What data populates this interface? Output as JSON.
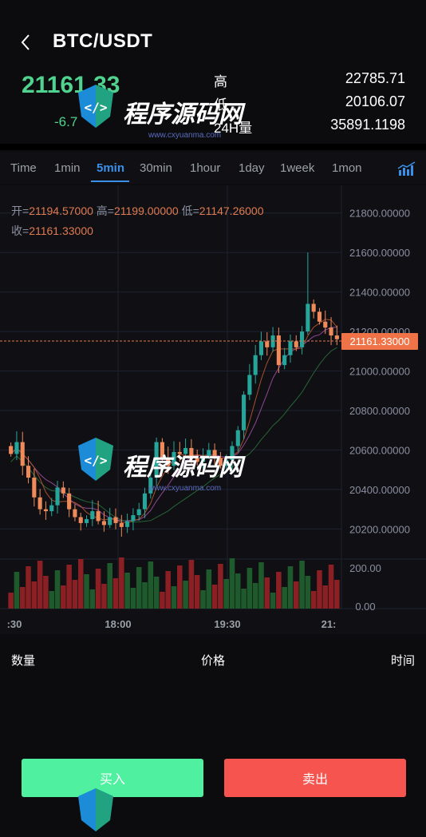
{
  "header": {
    "title": "BTC/USDT",
    "price": "21161.33",
    "change": "-6.7",
    "stats": [
      {
        "label": "高",
        "value": "22785.71"
      },
      {
        "label": "低",
        "value": "20106.07"
      },
      {
        "label": "24H量",
        "value": "35891.1198"
      }
    ]
  },
  "tabs": [
    "Time",
    "1min",
    "5min",
    "30min",
    "1hour",
    "1day",
    "1week",
    "1mon"
  ],
  "active_tab": "5min",
  "ohlc": {
    "open_label": "开=",
    "open": "21194.57000",
    "high_label": "高=",
    "high": "21199.00000",
    "low_label": "低=",
    "low": "21147.26000",
    "close_label": "收=",
    "close": "21161.33000"
  },
  "chart_data": {
    "type": "candlestick",
    "y_ticks": [
      "21800.00000",
      "21600.00000",
      "21400.00000",
      "21200.00000",
      "21000.00000",
      "20800.00000",
      "20600.00000",
      "20400.00000",
      "20200.00000"
    ],
    "ylim": [
      20080,
      21900
    ],
    "last_price_label": "21161.33000",
    "x_ticks": [
      ":30",
      "18:00",
      "19:30",
      "21:"
    ],
    "volume_ticks": [
      "200.00",
      "0.00"
    ]
  },
  "orderbook": {
    "qty": "数量",
    "price": "价格",
    "time": "时间"
  },
  "buttons": {
    "buy": "买入",
    "sell": "卖出"
  },
  "watermark": {
    "text": "程序源码网",
    "url": "www.cxyuanma.com"
  },
  "colors": {
    "up": "#26a69a",
    "down": "#ef5350",
    "green_text": "#4fd38e",
    "accent": "#3a8fe8"
  }
}
